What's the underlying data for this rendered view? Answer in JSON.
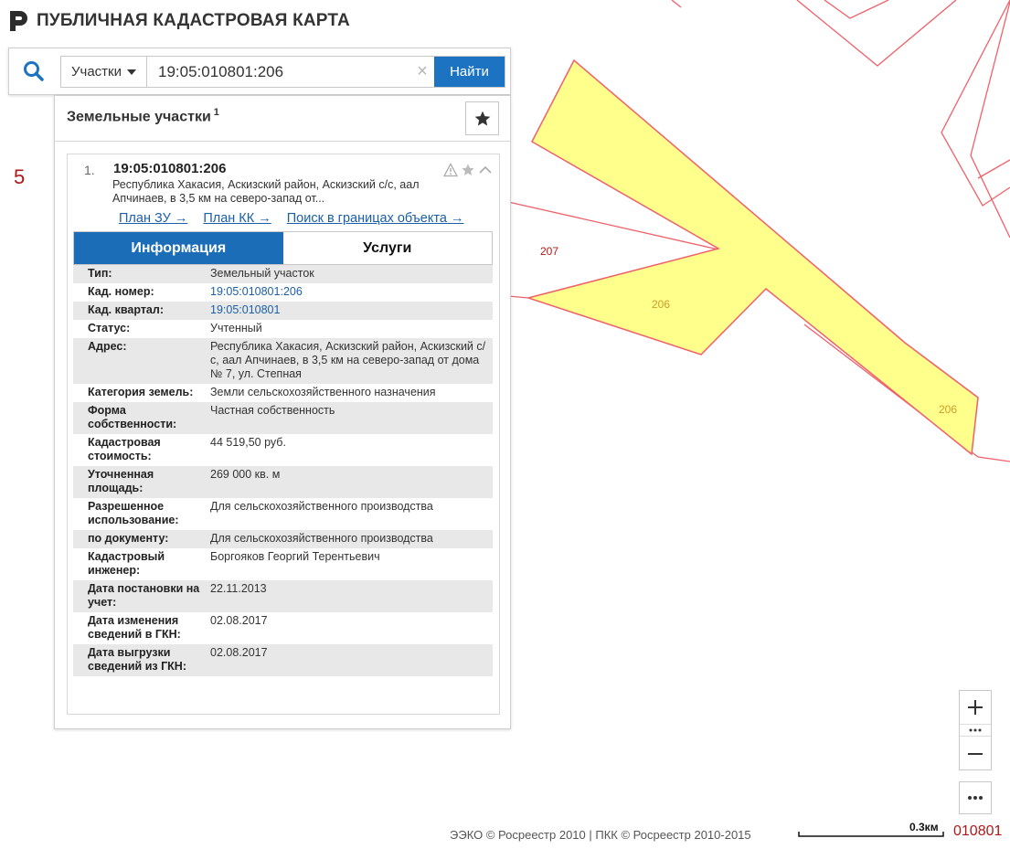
{
  "header": {
    "title": "ПУБЛИЧНАЯ КАДАСТРОВАЯ КАРТА"
  },
  "search": {
    "type_selected": "Участки",
    "query": "19:05:010801:206",
    "find_label": "Найти",
    "clear_symbol": "×"
  },
  "results": {
    "title": "Земельные участки",
    "count": "1",
    "item": {
      "number": "1.",
      "cadnum": "19:05:010801:206",
      "address_short": "Республика Хакасия, Аскизский район, Аскизский с/с, аал Апчинаев, в 3,5 км на северо-запад от...",
      "links": [
        "План ЗУ →",
        "План КК →",
        "Поиск в границах объекта →"
      ],
      "tabs": {
        "info": "Информация",
        "services": "Услуги"
      }
    },
    "info": [
      {
        "label": "Тип:",
        "value": "Земельный участок"
      },
      {
        "label": "Кад. номер:",
        "value": "19:05:010801:206",
        "link": true
      },
      {
        "label": "Кад. квартал:",
        "value": "19:05:010801",
        "link": true
      },
      {
        "label": "Статус:",
        "value": "Учтенный"
      },
      {
        "label": "Адрес:",
        "value": "Республика Хакасия, Аскизский район, Аскизский с/с, аал Апчинаев, в 3,5 км на северо-запад от дома № 7, ул. Степная"
      },
      {
        "label": "Категория земель:",
        "value": "Земли сельскохозяйственного назначения"
      },
      {
        "label": "Форма собственности:",
        "value": "Частная собственность"
      },
      {
        "label": "Кадастровая стоимость:",
        "value": "44 519,50 руб."
      },
      {
        "label": "Уточненная площадь:",
        "value": "269 000 кв. м"
      },
      {
        "label": "Разрешенное использование:",
        "value": "Для сельскохозяйственного производства"
      },
      {
        "label": "по документу:",
        "value": "Для сельскохозяйственного производства"
      },
      {
        "label": "Кадастровый инженер:",
        "value": "Боргояков Георгий Терентьевич"
      },
      {
        "label": "Дата постановки на учет:",
        "value": "22.11.2013"
      },
      {
        "label": "Дата изменения сведений в ГКН:",
        "value": "02.08.2017"
      },
      {
        "label": "Дата выгрузки сведений из ГКН:",
        "value": "02.08.2017"
      }
    ]
  },
  "map": {
    "parcel_labels": [
      "207",
      "206",
      "206"
    ],
    "side_number": "5",
    "copyright": "ЭЭКО © Росреестр 2010 | ПКК © Росреестр 2010-2015",
    "scale": "0.3км",
    "quarter": "010801",
    "colors": {
      "parcel_fill": "#ffff8c",
      "boundary": "#f0606a",
      "accent": "#1b73c2"
    }
  },
  "controls": {
    "zoom_in": "+",
    "zoom_out": "−",
    "more": "•••"
  }
}
